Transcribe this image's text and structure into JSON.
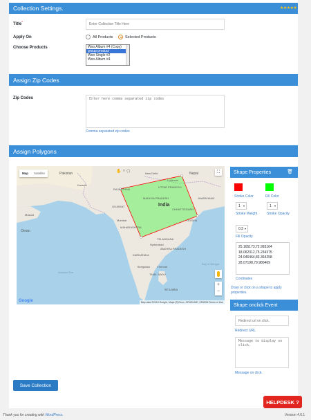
{
  "header": {
    "title": "Collection Settings.",
    "stars": "★★★★★"
  },
  "form": {
    "title_label": "Title",
    "title_required": "*",
    "title_placeholder": "Enter Collection Title Here",
    "apply_on_label": "Apply On",
    "apply_options": [
      "All Products",
      "Selected Products"
    ],
    "apply_selected": "Selected Products",
    "choose_products_label": "Choose Products",
    "products": [
      "Woo Album #4 (Copy)",
      "group product",
      "Woo Single #2",
      "Woo Album #4"
    ],
    "selected_product": "group product"
  },
  "zip": {
    "section_title": "Assign Zip Codes",
    "label": "Zip Codes",
    "placeholder": "Enter here comma separated zip codes",
    "hint": "Comma separated zip codes"
  },
  "polygons": {
    "section_title": "Assign Polygons",
    "map_tabs": [
      "Map",
      "Satellite"
    ],
    "map_labels": {
      "india": "India",
      "madhya_pradesh": "MADHYA PRADESH",
      "gujarat": "GUJARAT",
      "maharashtra": "MAHARASHTRA",
      "rajasthan": "RAJASTHAN",
      "uttar_pradesh": "UTTAR PRADESH",
      "chhattisgarh": "CHHATTISGARH",
      "odisha": "ODISHA",
      "telangana": "TELANGANA",
      "karnataka": "KARNATAKA",
      "tamil_nadu": "TAMIL NADU",
      "andhra": "ANDHRA PRADESH",
      "jharkhand": "JHARKHAND",
      "lucknow": "Lucknow",
      "new_delhi": "New Delhi",
      "karachi": "Karachi",
      "pakistan": "Pakistan",
      "nepal": "Nepal",
      "mumbai": "Mumbai",
      "hyderabad": "Hyderabad",
      "bengaluru": "Bengaluru",
      "chennai": "Chennai",
      "sri_lanka": "Sri Lanka",
      "muscat": "Muscat",
      "oman": "Oman",
      "arabian_sea": "Arabian Sea",
      "bay_of_bengal": "Bay of Bengal",
      "google": "Google",
      "footer": "Map data ©2016 Google, Maps (©)Genc, ORION-ME, ZENRIN    Terms of Use"
    }
  },
  "shape_properties": {
    "title": "Shape Properties",
    "stroke_color_label": "Stroke Color",
    "fill_color_label": "Fill Color",
    "stroke_color": "#ff0000",
    "fill_color": "#00ff00",
    "stroke_weight_value": "1",
    "stroke_weight_label": "Stroke Weight",
    "stroke_opacity_value": "1",
    "stroke_opacity_label": "Stroke Opacity",
    "fill_opacity_value": "0.3",
    "fill_opacity_label": "Fill Opacity",
    "coordinates": [
      "25.165173,72.993164",
      "18.062312,75.234375",
      "24.046464,83.364258",
      "28.07198,79.980469"
    ],
    "coordinates_label": "Cordinates",
    "hint": "Draw or click on a shape to apply properties."
  },
  "onclick_event": {
    "title": "Shape onclick Event",
    "redirect_placeholder": "Redirect url on click.",
    "redirect_label": "Redirect URL",
    "message_placeholder": "Message to display on click.",
    "message_label": "Message on click."
  },
  "save_button": "Save Collection",
  "footer": {
    "thanks_prefix": "Thank you for creating with ",
    "thanks_link": "WordPress",
    "thanks_suffix": ".",
    "version": "Version 4.6.1"
  },
  "helpdesk": "HELPDESK ?"
}
